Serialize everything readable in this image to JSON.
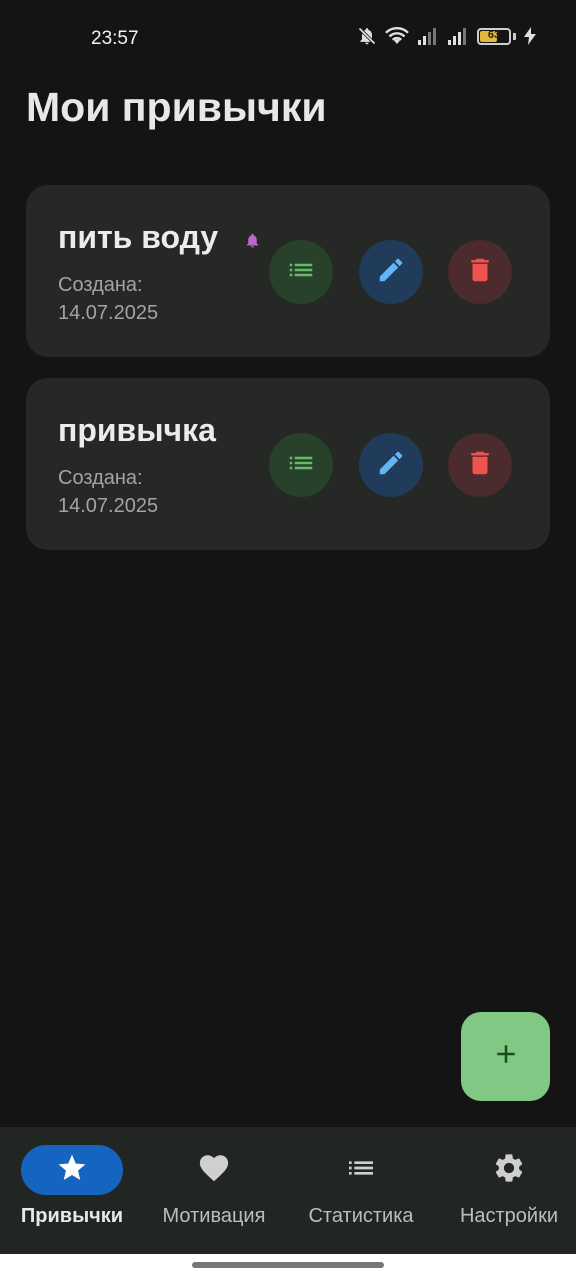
{
  "status_bar": {
    "time": "23:57",
    "battery_level": "63",
    "battery_fraction": 0.63,
    "icons": [
      "bell-off-icon",
      "wifi-icon",
      "signal-icon",
      "signal-icon",
      "battery-icon",
      "charging-icon"
    ]
  },
  "page": {
    "title": "Мои привычки"
  },
  "habits": [
    {
      "name": "пить воду",
      "has_reminder": true,
      "created_label": "Создана:",
      "created_date": "14.07.2025"
    },
    {
      "name": "привычка",
      "has_reminder": false,
      "created_label": "Создана:",
      "created_date": "14.07.2025"
    }
  ],
  "card_actions": [
    "list-icon",
    "pencil-icon",
    "trash-icon"
  ],
  "fab": {
    "icon": "plus-icon"
  },
  "bottom_nav": {
    "items": [
      {
        "label": "Привычки",
        "icon": "star-icon",
        "active": true
      },
      {
        "label": "Мотивация",
        "icon": "heart-icon",
        "active": false
      },
      {
        "label": "Статистика",
        "icon": "list-icon",
        "active": false
      },
      {
        "label": "Настройки",
        "icon": "gear-icon",
        "active": false
      }
    ]
  },
  "colors": {
    "background": "#141414",
    "card": "#252825",
    "list_accent": "#66bb6a",
    "edit_accent": "#64b5f6",
    "delete_accent": "#ef5350",
    "reminder_accent": "#ba68c8",
    "fab": "#81c884",
    "nav_active": "#1565c0"
  }
}
